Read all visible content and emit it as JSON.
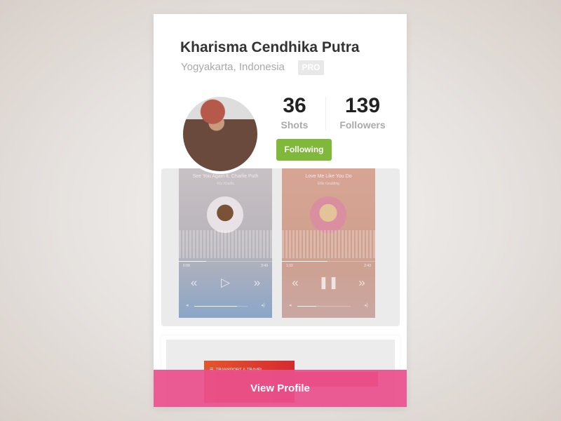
{
  "profile": {
    "name": "Kharisma Cendhika Putra",
    "location": "Yogyakarta, Indonesia",
    "badge": "PRO",
    "stats": [
      {
        "value": "36",
        "label": "Shots"
      },
      {
        "value": "139",
        "label": "Followers"
      }
    ],
    "follow_label": "Following",
    "follow_color": "#7fb83a"
  },
  "shots": {
    "players": [
      {
        "song": "See You Again ft. Charlie Puth",
        "artist": "Wiz Khalifa",
        "elapsed": "0:08",
        "total": "3:49",
        "progress": 0.29,
        "volume": 0.8,
        "state": "paused",
        "play_icon": "▷"
      },
      {
        "song": "Love Me Like You Do",
        "artist": "Ellie Goulding",
        "elapsed": "1:32",
        "total": "2:43",
        "progress": 0.49,
        "volume": 0.35,
        "state": "playing",
        "play_icon": "❚❚"
      }
    ],
    "second_shot": {
      "menu_title": "TRANSPORT & TRAVEL"
    }
  },
  "cta": {
    "label": "View Profile",
    "color": "#ea508c"
  }
}
